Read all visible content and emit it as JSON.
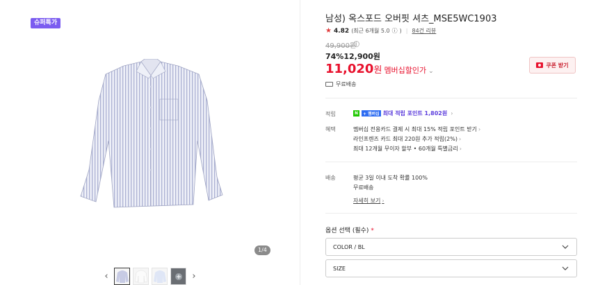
{
  "gallery": {
    "badge": "슈퍼특가",
    "counter": "1/4",
    "prev": "‹",
    "next": "›",
    "thumbs": 4
  },
  "product": {
    "title": "남성) 옥스포드 오버핏 셔츠_MSE5WC1903",
    "rating": {
      "star": "★",
      "score": "4.82",
      "detail": "(최근 6개월 5.0",
      "info": "ⓘ",
      "detail_close": ")",
      "reviews": "84건 리뷰"
    },
    "original_price": "49,900원",
    "price_info_icon": "i",
    "sale": "74%12,900원",
    "member_price": "11,020",
    "member_unit": "원",
    "member_label": "멤버십할인가",
    "member_chevron": "⌄",
    "coupon_label": "쿠폰 받기",
    "shipping": "무료배송"
  },
  "benefits": {
    "point_label": "적립",
    "np_badge": "N",
    "plus_badge": "+ 멤버십",
    "point_text": "최대 적립 포인트 1,802원",
    "benefit_label": "혜택",
    "benefit_lines": [
      "멤버십 전용카드 결제 시 최대 15% 적립 포인트 받기",
      "라인프렌즈 카드 최대 220원 추가 적립(2%)",
      "최대 12개월 무이자 할부 • 60개월 특별금리"
    ],
    "chevron": "›"
  },
  "delivery": {
    "label": "배송",
    "line1": "평균 3일 이내 도착 확률 100%",
    "line2": "무료배송",
    "detail_link": "자세히 보기",
    "chevron": "›"
  },
  "options": {
    "title": "옵션 선택 (필수)",
    "required_mark": "*",
    "color_value": "COLOR / BL",
    "size_value": "SIZE"
  },
  "colors": {
    "accent_red": "#e8112d",
    "badge_purple": "#7b5cf0",
    "point_purple": "#5b3cdc"
  }
}
